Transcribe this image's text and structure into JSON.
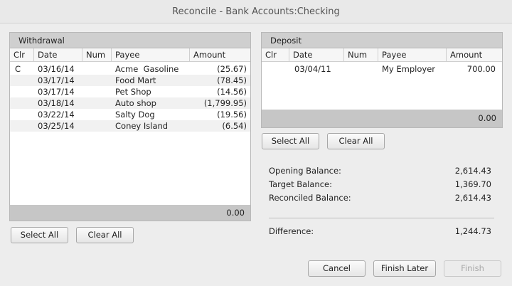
{
  "window": {
    "title": "Reconcile - Bank Accounts:Checking"
  },
  "withdrawal": {
    "title": "Withdrawal",
    "columns": [
      "Clr",
      "Date",
      "Num",
      "Payee",
      "Amount"
    ],
    "rows": [
      {
        "clr": "C",
        "date": "03/16/14",
        "num": "",
        "payee": "Acme  Gasoline",
        "amount": "(25.67)"
      },
      {
        "clr": "",
        "date": "03/17/14",
        "num": "",
        "payee": "Food Mart",
        "amount": "(78.45)"
      },
      {
        "clr": "",
        "date": "03/17/14",
        "num": "",
        "payee": "Pet Shop",
        "amount": "(14.56)"
      },
      {
        "clr": "",
        "date": "03/18/14",
        "num": "",
        "payee": "Auto shop",
        "amount": "(1,799.95)"
      },
      {
        "clr": "",
        "date": "03/22/14",
        "num": "",
        "payee": "Salty Dog",
        "amount": "(19.56)"
      },
      {
        "clr": "",
        "date": "03/25/14",
        "num": "",
        "payee": "Coney Island",
        "amount": "(6.54)"
      }
    ],
    "total": "0.00",
    "select_all_label": "Select All",
    "clear_all_label": "Clear All"
  },
  "deposit": {
    "title": "Deposit",
    "columns": [
      "Clr",
      "Date",
      "Num",
      "Payee",
      "Amount"
    ],
    "rows": [
      {
        "clr": "",
        "date": "03/04/11",
        "num": "",
        "payee": "My Employer",
        "amount": "700.00"
      }
    ],
    "total": "0.00",
    "select_all_label": "Select All",
    "clear_all_label": "Clear All"
  },
  "summary": {
    "opening_label": "Opening Balance:",
    "opening_value": "2,614.43",
    "target_label": "Target Balance:",
    "target_value": "1,369.70",
    "reconciled_label": "Reconciled Balance:",
    "reconciled_value": "2,614.43",
    "difference_label": "Difference:",
    "difference_value": "1,244.73"
  },
  "footer": {
    "cancel_label": "Cancel",
    "finish_later_label": "Finish Later",
    "finish_label": "Finish"
  }
}
